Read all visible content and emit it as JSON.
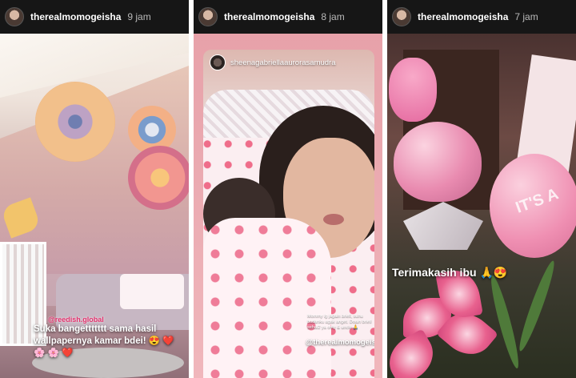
{
  "stories": [
    {
      "username": "therealmomogeisha",
      "time": "9 jam",
      "caption_tag": "@reedish.global",
      "caption": "Suka bangettttttt sama hasil wallpapernya kamar bdei! 😍 ❤️ 🌸 🌸 ❤️"
    },
    {
      "username": "therealmomogeisha",
      "time": "8 jam",
      "reposted_user": "sheenagabriellaaurorasamudra",
      "reposted_text": "Mommy lg jagain briell, suhu badanku agak anget. Doain briell sehat2 ya onty & uncle 🙏",
      "mention": "@therealmomogeisha"
    },
    {
      "username": "therealmomogeisha",
      "time": "7 jam",
      "balloon_text": "IT'S A",
      "caption": "Terimakasih ibu 🙏😍"
    }
  ],
  "colors": {
    "header_bg": "#161616",
    "username": "#ffffff",
    "time": "#b9b9b9",
    "tag_pink": "#e1306c"
  },
  "icons": [
    "avatar",
    "mini-avatar"
  ]
}
